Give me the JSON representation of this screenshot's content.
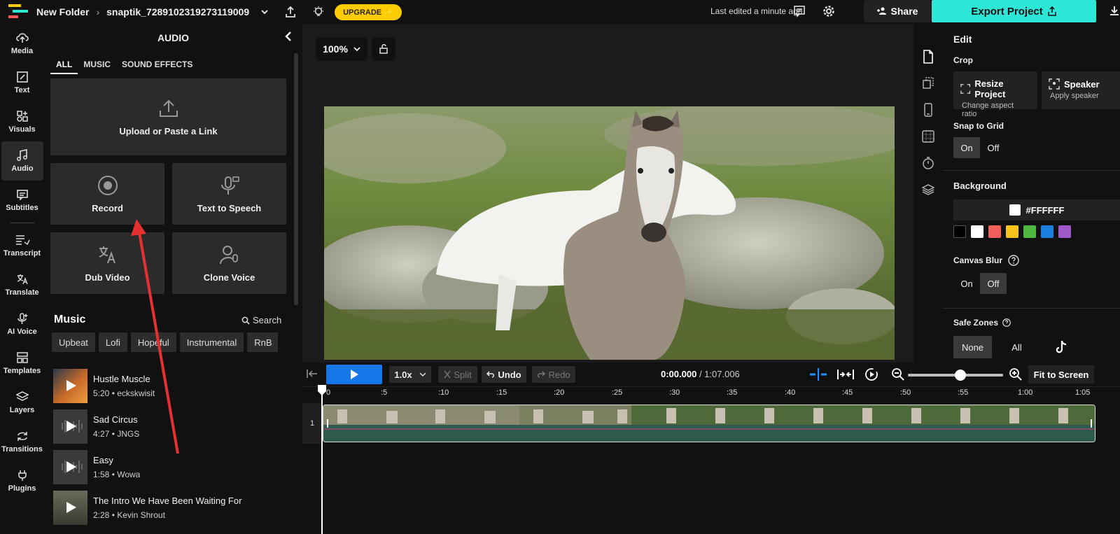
{
  "topbar": {
    "folder": "New Folder",
    "project_name": "snaptik_7289102319273119009",
    "upgrade_label": "UPGRADE ✨",
    "last_edited": "Last edited a minute ago",
    "share_label": "Share",
    "export_label": "Export Project"
  },
  "leftnav": {
    "items": [
      {
        "label": "Media",
        "icon": "upload-cloud-icon"
      },
      {
        "label": "Text",
        "icon": "edit-text-icon"
      },
      {
        "label": "Visuals",
        "icon": "shapes-icon"
      },
      {
        "label": "Audio",
        "icon": "music-note-icon",
        "active": true
      },
      {
        "label": "Subtitles",
        "icon": "subtitles-icon"
      },
      {
        "label": "Transcript",
        "icon": "transcript-icon"
      },
      {
        "label": "Translate",
        "icon": "translate-icon"
      },
      {
        "label": "AI Voice",
        "icon": "ai-voice-icon"
      },
      {
        "label": "Templates",
        "icon": "templates-icon"
      },
      {
        "label": "Layers",
        "icon": "layers-icon"
      },
      {
        "label": "Transitions",
        "icon": "transitions-icon"
      },
      {
        "label": "Plugins",
        "icon": "plug-icon"
      }
    ]
  },
  "panel": {
    "title": "AUDIO",
    "tabs": [
      "ALL",
      "MUSIC",
      "SOUND EFFECTS"
    ],
    "upload_label": "Upload or Paste a Link",
    "record_label": "Record",
    "tts_label": "Text to Speech",
    "dub_label": "Dub Video",
    "clone_label": "Clone Voice",
    "music_heading": "Music",
    "search_label": "Search",
    "chips": [
      "Upbeat",
      "Lofi",
      "Hopeful",
      "Instrumental",
      "RnB"
    ],
    "tracks": [
      {
        "title": "Hustle Muscle",
        "meta": "5:20 • eckskwisit"
      },
      {
        "title": "Sad Circus",
        "meta": "4:27 • JNGS"
      },
      {
        "title": "Easy",
        "meta": "1:58 • Wowa"
      },
      {
        "title": "The Intro We Have Been Waiting For",
        "meta": "2:28 • Kevin Shrout"
      }
    ]
  },
  "canvas": {
    "zoom": "100%"
  },
  "edit": {
    "title": "Edit",
    "crop_label": "Crop",
    "resize_title": "Resize Project",
    "resize_sub": "Change aspect ratio",
    "speaker_title": "Speaker",
    "speaker_sub": "Apply speaker",
    "snap_label": "Snap to Grid",
    "on_label": "On",
    "off_label": "Off",
    "background_label": "Background",
    "bg_color": "#FFFFFF",
    "swatches": [
      "#000000",
      "#ffffff",
      "#f0605a",
      "#f7c21a",
      "#4fb840",
      "#1a7fe0",
      "#a05ac8"
    ],
    "canvas_blur_label": "Canvas Blur",
    "safe_zones_label": "Safe Zones",
    "safe_none": "None",
    "safe_all": "All"
  },
  "timeline": {
    "speed": "1.0x",
    "split_label": "Split",
    "undo_label": "Undo",
    "redo_label": "Redo",
    "current_time": "0:00.000",
    "total_time": "/ 1:07.006",
    "fit_label": "Fit to Screen",
    "track_number": "1",
    "ruler_labels": [
      "0",
      ":5",
      ":10",
      ":15",
      ":20",
      ":25",
      ":30",
      ":35",
      ":40",
      ":45",
      ":50",
      ":55",
      "1:00",
      "1:05"
    ]
  }
}
